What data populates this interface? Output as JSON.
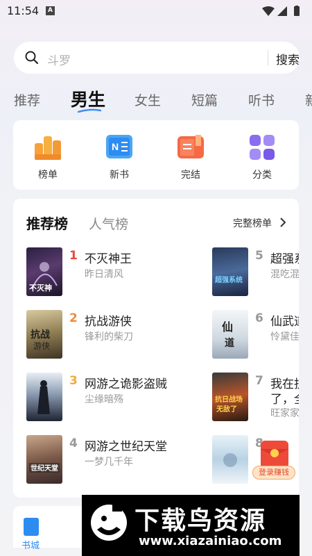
{
  "status_bar": {
    "time": "11:54",
    "a_badge": "A"
  },
  "search": {
    "placeholder": "斗罗",
    "button": "搜索"
  },
  "tabs": [
    "推荐",
    "男生",
    "女生",
    "短篇",
    "听书",
    "新"
  ],
  "active_tab": "男生",
  "quick_links": [
    {
      "label": "榜单",
      "icon": "trophy-icon"
    },
    {
      "label": "新书",
      "icon": "new-book-icon"
    },
    {
      "label": "完结",
      "icon": "finished-book-icon"
    },
    {
      "label": "分类",
      "icon": "category-grid-icon"
    }
  ],
  "ranking": {
    "tab_active": "推荐榜",
    "tab_other": "人气榜",
    "full_list": "完整榜单",
    "books": [
      {
        "rank": "1",
        "title": "不灭神王",
        "author": "昨日清风"
      },
      {
        "rank": "2",
        "title": "抗战游侠",
        "author": "锋利的柴刀"
      },
      {
        "rank": "3",
        "title": "网游之诡影盗贼",
        "author": "尘缘暗殇"
      },
      {
        "rank": "4",
        "title": "网游之世纪天堂",
        "author": "一梦几千年"
      },
      {
        "rank": "5",
        "title": "超强系",
        "author": "混吃混"
      },
      {
        "rank": "6",
        "title": "仙武道",
        "author": "怜黛佳"
      },
      {
        "rank": "7",
        "title": "我在抗",
        "title_line2": "了，全",
        "author": "旺家家"
      },
      {
        "rank": "8",
        "title": "",
        "author": ""
      }
    ]
  },
  "reward": {
    "label": "登录赚钱"
  },
  "nav": {
    "home": "书城"
  },
  "watermark": {
    "title": "下载鸟资源",
    "url": "www.xiazainiao.com"
  },
  "colors": {
    "rank1": "#e84a3c",
    "rank2": "#f08a3a",
    "rank3": "#f5a83a",
    "rank_other": "#999999",
    "accent": "#2d8cf0"
  }
}
